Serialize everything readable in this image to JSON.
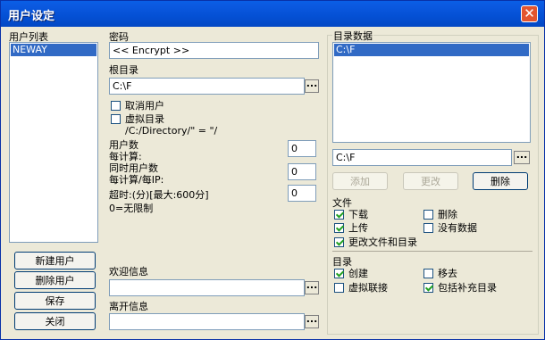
{
  "window": {
    "title": "用户设定"
  },
  "user_list": {
    "label": "用户列表",
    "items": [
      "NEWAY"
    ]
  },
  "buttons": {
    "new_user": "新建用户",
    "delete_user": "删除用户",
    "save": "保存",
    "close": "关闭"
  },
  "password": {
    "label": "密码",
    "value": "<< Encrypt >>"
  },
  "root_dir": {
    "label": "根目录",
    "value": "C:\\F"
  },
  "options": {
    "disable_user": "取消用户",
    "virtual_dir": "虚拟目录",
    "virtual_hint": "/C:/Directory/\" = \"/"
  },
  "users_count": {
    "label1": "用户数",
    "label2": "每计算:",
    "value": "0"
  },
  "concurrent": {
    "label1": "同时用户数",
    "label2": "每计算/每IP:",
    "value": "0"
  },
  "timeout": {
    "label1": "超时:(分)[最大:600分]",
    "label2": "0=无限制",
    "value": "0"
  },
  "welcome": {
    "label": "欢迎信息",
    "value": ""
  },
  "leave": {
    "label": "离开信息",
    "value": ""
  },
  "dir_data": {
    "label": "目录数据",
    "items": [
      "C:\\F"
    ],
    "path_value": "C:\\F"
  },
  "dir_buttons": {
    "add": "添加",
    "change": "更改",
    "delete": "删除"
  },
  "files": {
    "label": "文件",
    "download": "下载",
    "delete": "删除",
    "upload": "上传",
    "no_data": "没有数据",
    "modify": "更改文件和目录"
  },
  "dirs": {
    "label": "目录",
    "create": "创建",
    "move": "移去",
    "virtual_link": "虚拟联接",
    "include_sub": "包括补充目录"
  },
  "checks": {
    "disable_user": false,
    "virtual_dir": false,
    "download": true,
    "file_delete": false,
    "upload": true,
    "no_data": false,
    "modify": true,
    "create": true,
    "move": false,
    "virtual_link": false,
    "include_sub": true
  }
}
